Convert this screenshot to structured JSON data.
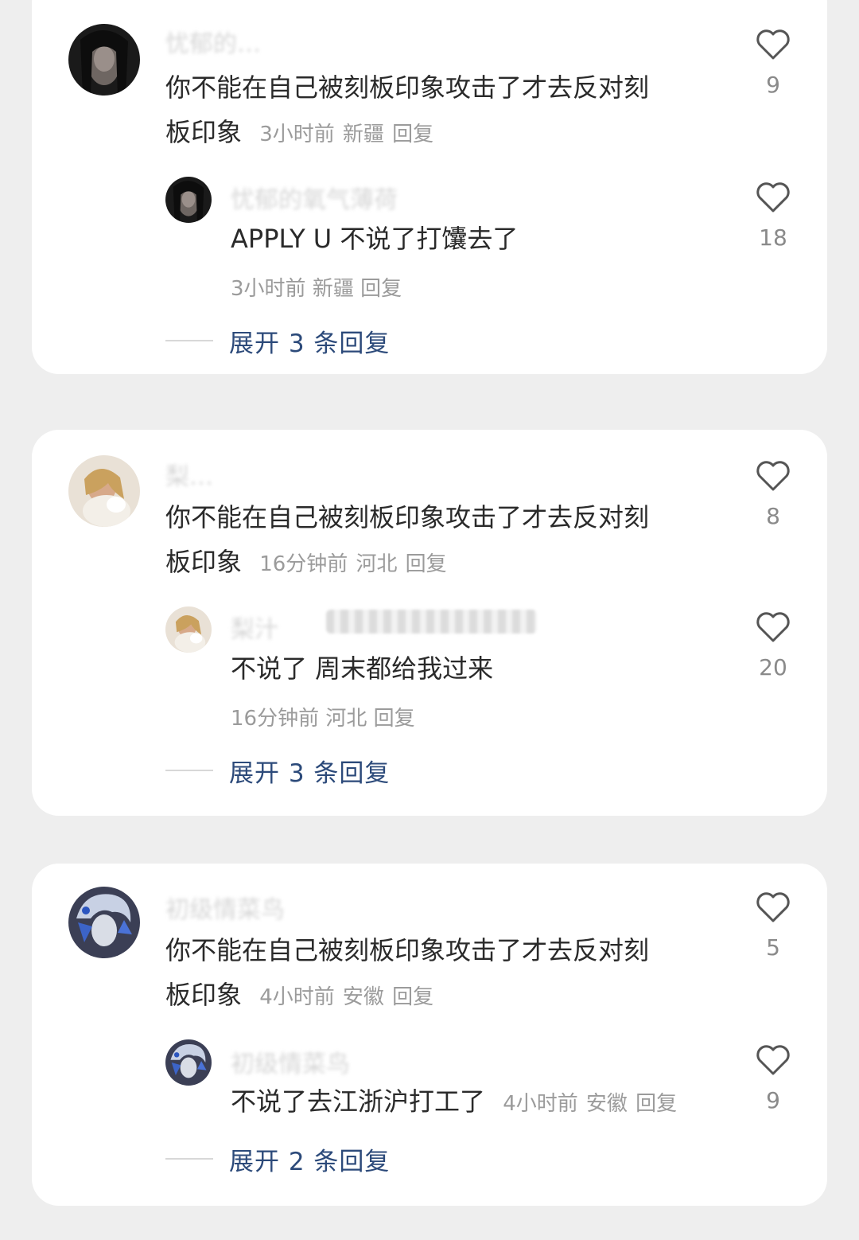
{
  "threads": [
    {
      "comment": {
        "username": "忧郁的…",
        "text_line1": "你不能在自己被刻板印象攻击了才去反对刻",
        "text_line2": "板印象",
        "time": "3小时前",
        "location": "新疆",
        "reply": "回复",
        "likes": "9"
      },
      "reply": {
        "username": "忧郁的氧气薄荷",
        "text": "APPLY U  不说了打馕去了",
        "time": "3小时前",
        "location": "新疆",
        "reply": "回复",
        "likes": "18"
      },
      "expand_label": "展开 3 条回复"
    },
    {
      "comment": {
        "username": "梨…",
        "text_line1": "你不能在自己被刻板印象攻击了才去反对刻",
        "text_line2": "板印象",
        "time": "16分钟前",
        "location": "河北",
        "reply": "回复",
        "likes": "8"
      },
      "reply": {
        "username": "梨汁",
        "text": "不说了 周末都给我过来",
        "time": "16分钟前",
        "location": "河北",
        "reply": "回复",
        "likes": "20"
      },
      "expand_label": "展开 3 条回复"
    },
    {
      "comment": {
        "username": "初级情菜鸟",
        "text_line1": "你不能在自己被刻板印象攻击了才去反对刻",
        "text_line2": "板印象",
        "time": "4小时前",
        "location": "安徽",
        "reply": "回复",
        "likes": "5"
      },
      "reply": {
        "username": "初级情菜鸟",
        "text": "不说了去江浙沪打工了",
        "time": "4小时前",
        "location": "安徽",
        "reply": "回复",
        "likes": "9"
      },
      "expand_label": "展开 2 条回复"
    }
  ],
  "icons": {
    "like": "heart-outline-icon",
    "heart_color": "#555555"
  },
  "colors": {
    "expand_link": "#2c4a7a",
    "meta": "#9b9b9b",
    "body_text": "#2a2a2a"
  }
}
